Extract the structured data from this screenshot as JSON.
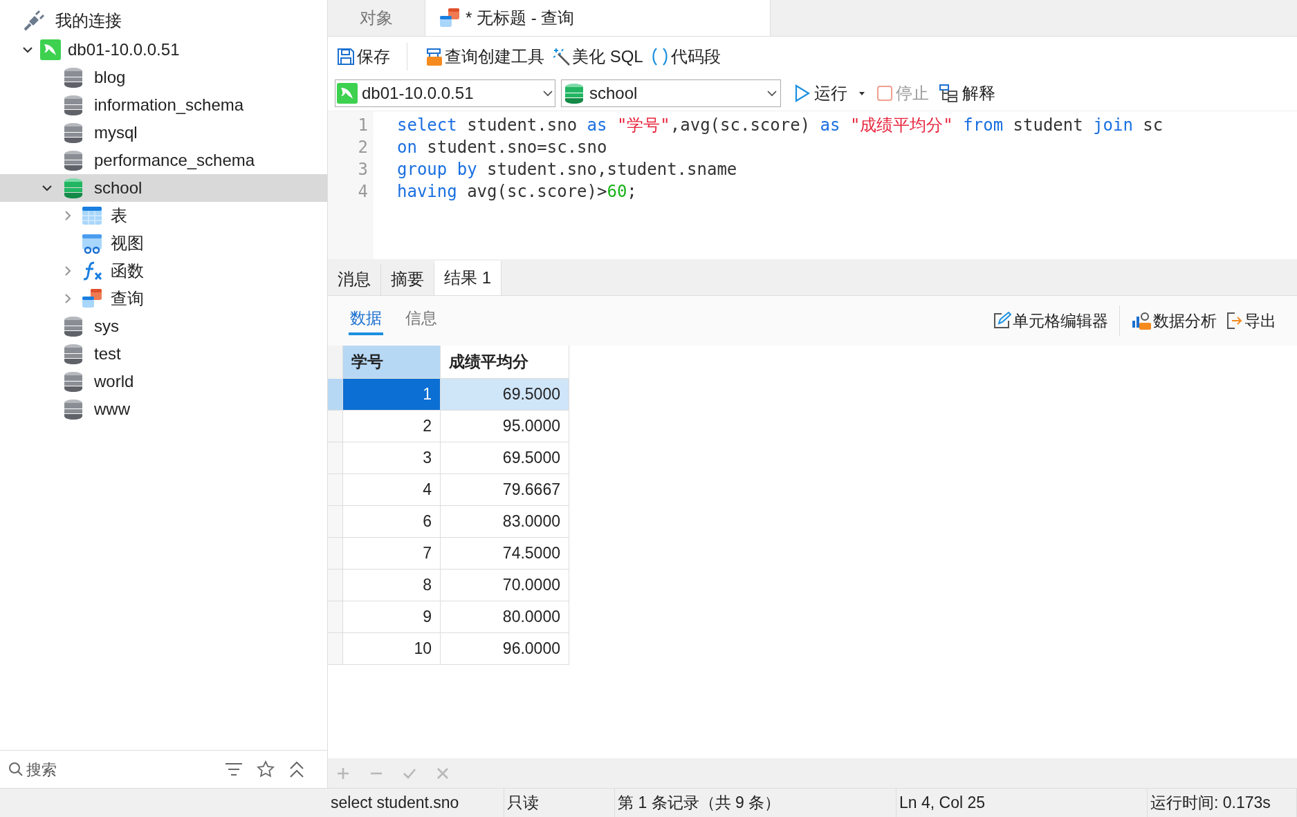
{
  "sidebar": {
    "title": "我的连接",
    "connection": {
      "label": "db01-10.0.0.51",
      "expanded": true,
      "databases": [
        {
          "label": "blog",
          "open": false,
          "expanded": false,
          "selected": false
        },
        {
          "label": "information_schema",
          "open": false,
          "expanded": false,
          "selected": false
        },
        {
          "label": "mysql",
          "open": false,
          "expanded": false,
          "selected": false
        },
        {
          "label": "performance_schema",
          "open": false,
          "expanded": false,
          "selected": false
        },
        {
          "label": "school",
          "open": true,
          "expanded": true,
          "selected": true,
          "children": [
            {
              "label": "表",
              "kind": "table",
              "has_children": true
            },
            {
              "label": "视图",
              "kind": "view",
              "has_children": false
            },
            {
              "label": "函数",
              "kind": "function",
              "has_children": true
            },
            {
              "label": "查询",
              "kind": "query",
              "has_children": true
            }
          ]
        },
        {
          "label": "sys",
          "open": false,
          "expanded": false,
          "selected": false
        },
        {
          "label": "test",
          "open": false,
          "expanded": false,
          "selected": false
        },
        {
          "label": "world",
          "open": false,
          "expanded": false,
          "selected": false
        },
        {
          "label": "www",
          "open": false,
          "expanded": false,
          "selected": false
        }
      ]
    },
    "search": {
      "placeholder": "搜索"
    }
  },
  "tabs": [
    {
      "label": "对象",
      "selected": false,
      "kind": "plain"
    },
    {
      "label": "* 无标题 - 查询",
      "selected": true,
      "kind": "query"
    }
  ],
  "toolbar": [
    {
      "label": "保存",
      "kind": "save"
    },
    {
      "label": "查询创建工具",
      "kind": "builder"
    },
    {
      "label": "美化 SQL",
      "kind": "beautify"
    },
    {
      "label": "代码段",
      "kind": "snippet"
    }
  ],
  "connection_select": {
    "value": "db01-10.0.0.51"
  },
  "database_select": {
    "value": "school"
  },
  "run_controls": [
    {
      "label": "运行",
      "kind": "run",
      "disabled": false
    },
    {
      "label": "停止",
      "kind": "stop",
      "disabled": true
    },
    {
      "label": "解释",
      "kind": "explain",
      "disabled": false
    }
  ],
  "editor": {
    "lines": [
      {
        "number": "1",
        "tokens": [
          {
            "text": "select",
            "kind": "keyword"
          },
          {
            "text": " student.sno ",
            "kind": "plain"
          },
          {
            "text": "as ",
            "kind": "keyword"
          },
          {
            "text": "\"学号\"",
            "kind": "string"
          },
          {
            "text": ",avg(sc.score) ",
            "kind": "plain"
          },
          {
            "text": "as ",
            "kind": "keyword"
          },
          {
            "text": "\"成绩平均分\"",
            "kind": "string"
          },
          {
            "text": " from",
            "kind": "keyword"
          },
          {
            "text": " student ",
            "kind": "plain"
          },
          {
            "text": "join",
            "kind": "keyword"
          },
          {
            "text": " sc",
            "kind": "plain"
          }
        ]
      },
      {
        "number": "2",
        "tokens": [
          {
            "text": "on",
            "kind": "keyword"
          },
          {
            "text": " student.sno=sc.sno",
            "kind": "plain"
          }
        ]
      },
      {
        "number": "3",
        "tokens": [
          {
            "text": "group by",
            "kind": "keyword"
          },
          {
            "text": " student.sno,student.sname",
            "kind": "plain"
          }
        ]
      },
      {
        "number": "4",
        "tokens": [
          {
            "text": "having",
            "kind": "keyword"
          },
          {
            "text": " avg(sc.score)>",
            "kind": "plain"
          },
          {
            "text": "60",
            "kind": "number"
          },
          {
            "text": ";",
            "kind": "plain"
          }
        ]
      }
    ]
  },
  "result_tabs": [
    {
      "label": "消息",
      "selected": false
    },
    {
      "label": "摘要",
      "selected": false
    },
    {
      "label": "结果 1",
      "selected": true
    }
  ],
  "view_tabs": [
    {
      "label": "数据",
      "selected": true
    },
    {
      "label": "信息",
      "selected": false
    }
  ],
  "result_tools": [
    {
      "label": "单元格编辑器",
      "kind": "edit"
    },
    {
      "label": "数据分析",
      "kind": "analyze"
    },
    {
      "label": "导出",
      "kind": "export"
    }
  ],
  "table": {
    "columns": [
      {
        "label": "学号",
        "selected": true
      },
      {
        "label": "成绩平均分",
        "selected": false
      }
    ],
    "rows": [
      {
        "cells": [
          "1",
          "69.5000"
        ],
        "selected": true
      },
      {
        "cells": [
          "2",
          "95.0000"
        ],
        "selected": false
      },
      {
        "cells": [
          "3",
          "69.5000"
        ],
        "selected": false
      },
      {
        "cells": [
          "4",
          "79.6667"
        ],
        "selected": false
      },
      {
        "cells": [
          "6",
          "83.0000"
        ],
        "selected": false
      },
      {
        "cells": [
          "7",
          "74.5000"
        ],
        "selected": false
      },
      {
        "cells": [
          "8",
          "70.0000"
        ],
        "selected": false
      },
      {
        "cells": [
          "9",
          "80.0000"
        ],
        "selected": false
      },
      {
        "cells": [
          "10",
          "96.0000"
        ],
        "selected": false
      }
    ]
  },
  "grid_actions": [
    {
      "kind": "add",
      "disabled": true
    },
    {
      "kind": "remove",
      "disabled": true
    },
    {
      "kind": "apply",
      "disabled": true
    },
    {
      "kind": "cancel",
      "disabled": true
    }
  ],
  "status_bar": [
    "select student.sno",
    "只读",
    "第 1 条记录（共 9 条）",
    "Ln 4, Col 25",
    "运行时间: 0.173s"
  ]
}
